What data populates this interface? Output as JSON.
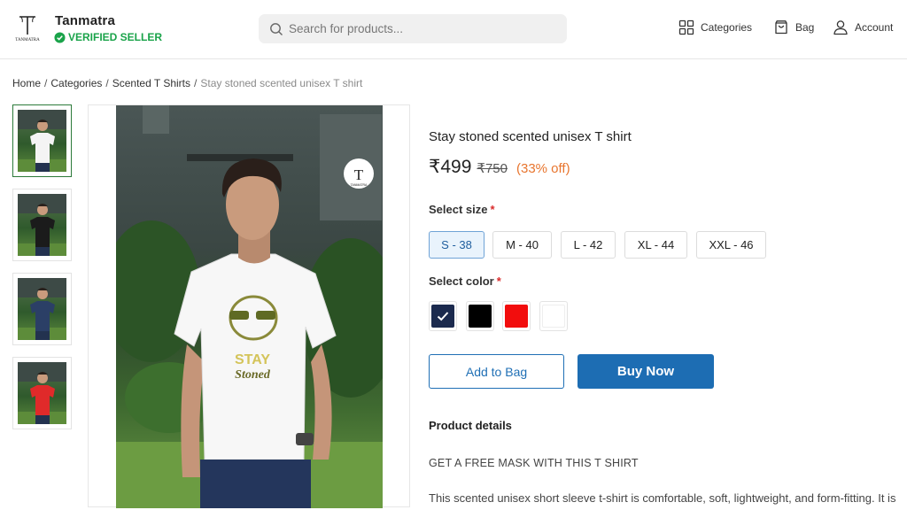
{
  "header": {
    "logo_letter": "T",
    "logo_text": "TANMATRA",
    "brand_name": "Tanmatra",
    "verified_label": "VERIFIED SELLER",
    "search_placeholder": "Search for products...",
    "nav": {
      "categories": "Categories",
      "bag": "Bag",
      "account": "Account"
    }
  },
  "breadcrumb": {
    "items": [
      "Home",
      "Categories",
      "Scented T Shirts"
    ],
    "current": "Stay stoned scented unisex T shirt",
    "separator": "/"
  },
  "gallery": {
    "thumbnails": [
      {
        "shirt_color": "#f4f4f4",
        "selected": true
      },
      {
        "shirt_color": "#1b1b1b",
        "selected": false
      },
      {
        "shirt_color": "#2b3f66",
        "selected": false
      },
      {
        "shirt_color": "#e02a2a",
        "selected": false
      }
    ],
    "main_image": {
      "shirt_color": "#f7f7f7",
      "watermark_letter": "T",
      "watermark_text": "TANMATRA",
      "print_text_line1": "STAY",
      "print_text_line2": "Stoned"
    }
  },
  "product": {
    "title": "Stay stoned scented unisex T shirt",
    "price": "₹499",
    "mrp": "₹750",
    "discount": "(33% off)",
    "size_label": "Select size",
    "required_mark": "*",
    "sizes": [
      "S - 38",
      "M - 40",
      "L - 42",
      "XL - 44",
      "XXL - 46"
    ],
    "selected_size": "S - 38",
    "color_label": "Select color",
    "colors": [
      {
        "name": "navy",
        "hex": "#1b2a4e",
        "selected": true
      },
      {
        "name": "black",
        "hex": "#000000",
        "selected": false
      },
      {
        "name": "red",
        "hex": "#f20d0d",
        "selected": false
      },
      {
        "name": "white",
        "hex": "#ffffff",
        "selected": false
      }
    ],
    "add_to_bag": "Add to Bag",
    "buy_now": "Buy Now",
    "details_heading": "Product details",
    "promo": "GET A FREE MASK WITH THIS T SHIRT",
    "description": "This scented unisex short sleeve t-shirt is comfortable, soft, lightweight, and form-fitting. It is made of all natural products and stitched to perfection."
  },
  "colors": {
    "accent_blue": "#1d6db3",
    "verified_green": "#1aa34a",
    "discount_orange": "#e8752e",
    "required_red": "#d92b2b"
  }
}
